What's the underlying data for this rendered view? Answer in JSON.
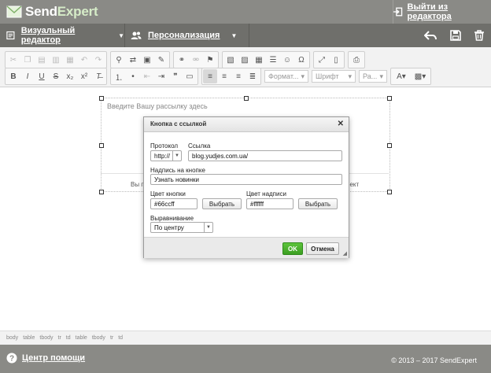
{
  "header": {
    "logo_send": "Send",
    "logo_expert": "Expert",
    "exit_label": "Выйти из редактора"
  },
  "subbar": {
    "visual_editor": "Визуальный редактор",
    "personalization": "Персонализация"
  },
  "toolbar": {
    "format_label": "Формат...",
    "font_label": "Шрифт",
    "size_label": "Ра..."
  },
  "editor": {
    "placeholder": "Введите Вашу рассылку здесь",
    "partial_left": "Вы п",
    "partial_right": "оект"
  },
  "statusbar": {
    "path": [
      "body",
      "table",
      "tbody",
      "tr",
      "td",
      "table",
      "tbody",
      "tr",
      "td"
    ]
  },
  "footer": {
    "help": "Центр помощи",
    "copyright": "© 2013 – 2017 SendExpert"
  },
  "dialog": {
    "title": "Кнопка с ссылкой",
    "protocol_label": "Протокол",
    "protocol_value": "http://",
    "link_label": "Ссылка",
    "link_value": "blog.yudjes.com.ua/",
    "caption_label": "Надпись на кнопке",
    "caption_value": "Узнать новинки",
    "button_color_label": "Цвет кнопки",
    "button_color_value": "#66ccff",
    "text_color_label": "Цвет надписи",
    "text_color_value": "#ffffff",
    "pick_label": "Выбрать",
    "align_label": "Выравнивание",
    "align_value": "По центру",
    "ok_label": "OK",
    "cancel_label": "Отмена"
  },
  "colors": {
    "header_bg": "#8a8a86",
    "subbar_bg": "#6f6f6b",
    "ok_green": "#4cb32e"
  }
}
